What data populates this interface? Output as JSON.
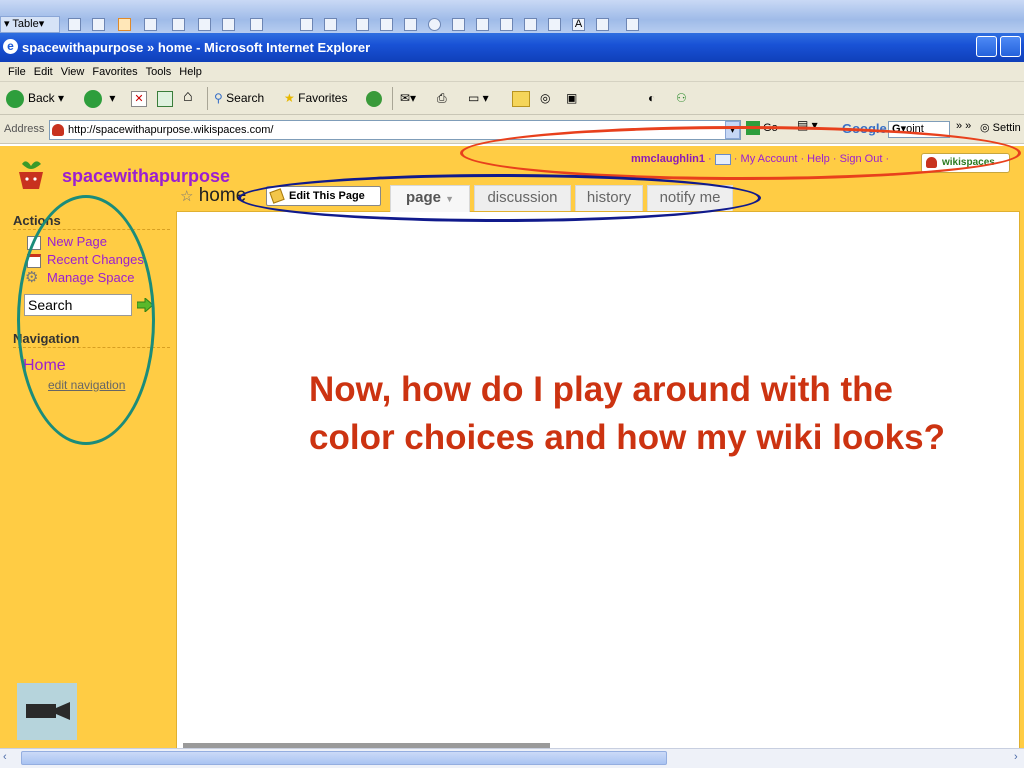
{
  "office_toolbar": {
    "table_label": "Table"
  },
  "window": {
    "title": "spacewithapurpose » home - Microsoft Internet Explorer"
  },
  "menu": [
    "File",
    "Edit",
    "View",
    "Favorites",
    "Tools",
    "Help"
  ],
  "toolbar": {
    "back": "Back",
    "search": "Search",
    "favorites": "Favorites"
  },
  "address": {
    "label": "Address",
    "url": "http://spacewithapurpose.wikispaces.com/",
    "go": "Go",
    "google": "Google",
    "google_field": "oint",
    "settings": "Settin"
  },
  "wiki": {
    "site_title": "spacewithapurpose",
    "page_name": "home",
    "username": "mmclaughlin1",
    "user_links": [
      "My Account",
      "Help",
      "Sign Out"
    ],
    "badge": "wikispaces",
    "edit_button": "Edit This Page",
    "tabs": [
      "page",
      "discussion",
      "history",
      "notify me"
    ]
  },
  "sidebar": {
    "actions_heading": "Actions",
    "actions": [
      "New Page",
      "Recent Changes",
      "Manage Space"
    ],
    "search_placeholder": "Search",
    "navigation_heading": "Navigation",
    "nav_home": "Home",
    "edit_navigation": "edit navigation"
  },
  "main": {
    "text": "Now, how do I play around with the color choices and how my wiki looks?"
  },
  "colors": {
    "annotation_red": "#e8401c",
    "annotation_blue": "#101a8c",
    "annotation_teal": "#1b8c7a",
    "wiki_bg": "#ffcc44",
    "link_purple": "#9b1fd1",
    "heading_red": "#cc3311"
  }
}
